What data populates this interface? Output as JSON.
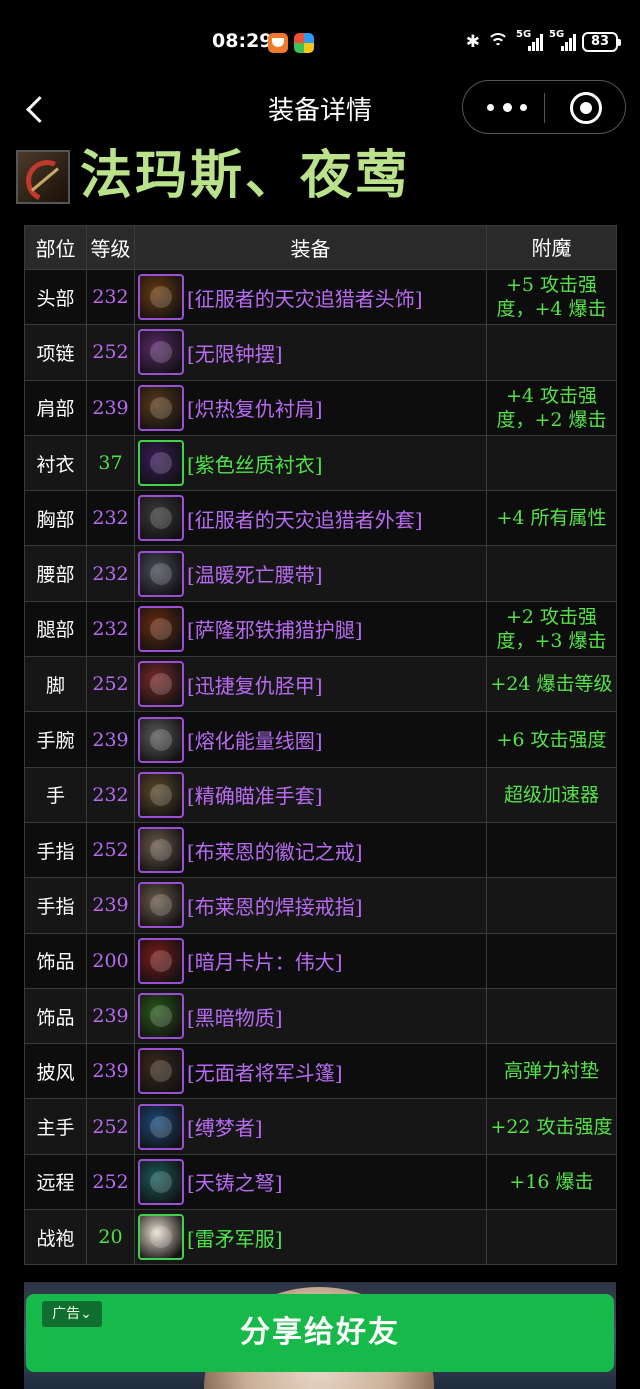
{
  "status_bar": {
    "time": "08:29",
    "network1": "5G",
    "network2": "5G",
    "battery": "83"
  },
  "nav": {
    "title": "装备详情"
  },
  "character": {
    "name": "法玛斯、夜莺"
  },
  "table": {
    "headers": {
      "slot": "部位",
      "level": "等级",
      "item": "装备",
      "enchant": "附魔"
    },
    "rows": [
      {
        "slot": "头部",
        "level": "232",
        "item": "[征服者的天灾追猎者头饰]",
        "enchant": "+5 攻击强度，+4 爆击",
        "quality": "epic",
        "icon": "helm-icon",
        "icon_color": "#6b3a10"
      },
      {
        "slot": "项链",
        "level": "252",
        "item": "[无限钟摆]",
        "enchant": "",
        "quality": "epic",
        "icon": "pendulum-icon",
        "icon_color": "#5a2a6a"
      },
      {
        "slot": "肩部",
        "level": "239",
        "item": "[炽热复仇衬肩]",
        "enchant": "+4 攻击强度，+2 爆击",
        "quality": "epic",
        "icon": "shoulder-icon",
        "icon_color": "#5a3a1a"
      },
      {
        "slot": "衬衣",
        "level": "37",
        "item": "[紫色丝质衬衣]",
        "enchant": "",
        "quality": "green",
        "icon": "shirt-icon",
        "icon_color": "#3a1a5a"
      },
      {
        "slot": "胸部",
        "level": "232",
        "item": "[征服者的天灾追猎者外套]",
        "enchant": "+4 所有属性",
        "quality": "epic",
        "icon": "chest-armor-icon",
        "icon_color": "#3a3a3a"
      },
      {
        "slot": "腰部",
        "level": "232",
        "item": "[温暖死亡腰带]",
        "enchant": "",
        "quality": "epic",
        "icon": "belt-icon",
        "icon_color": "#4a4a5a"
      },
      {
        "slot": "腿部",
        "level": "232",
        "item": "[萨隆邪铁捕猎护腿]",
        "enchant": "+2 攻击强度，+3 爆击",
        "quality": "epic",
        "icon": "legs-icon",
        "icon_color": "#6a2a10"
      },
      {
        "slot": "脚",
        "level": "252",
        "item": "[迅捷复仇胫甲]",
        "enchant": "+24 爆击等级",
        "quality": "epic",
        "icon": "boots-icon",
        "icon_color": "#7a2a2a"
      },
      {
        "slot": "手腕",
        "level": "239",
        "item": "[熔化能量线圈]",
        "enchant": "+6 攻击强度",
        "quality": "epic",
        "icon": "bracer-icon",
        "icon_color": "#5a5a5a"
      },
      {
        "slot": "手",
        "level": "232",
        "item": "[精确瞄准手套]",
        "enchant": "超级加速器",
        "quality": "epic",
        "icon": "gloves-icon",
        "icon_color": "#5a4a2a"
      },
      {
        "slot": "手指",
        "level": "252",
        "item": "[布莱恩的徽记之戒]",
        "enchant": "",
        "quality": "epic",
        "icon": "ring-icon",
        "icon_color": "#6a5a4a"
      },
      {
        "slot": "手指",
        "level": "239",
        "item": "[布莱恩的焊接戒指]",
        "enchant": "",
        "quality": "epic",
        "icon": "ring-icon",
        "icon_color": "#6a5a4a"
      },
      {
        "slot": "饰品",
        "level": "200",
        "item": "[暗月卡片：伟大]",
        "enchant": "",
        "quality": "epic",
        "icon": "card-icon",
        "icon_color": "#7a1a1a"
      },
      {
        "slot": "饰品",
        "level": "239",
        "item": "[黑暗物质]",
        "enchant": "",
        "quality": "epic",
        "icon": "orb-icon",
        "icon_color": "#2a5a1a"
      },
      {
        "slot": "披风",
        "level": "239",
        "item": "[无面者将军斗篷]",
        "enchant": "高弹力衬垫",
        "quality": "epic",
        "icon": "cloak-icon",
        "icon_color": "#3a2a1a"
      },
      {
        "slot": "主手",
        "level": "252",
        "item": "[缚梦者]",
        "enchant": "+22 攻击强度",
        "quality": "epic",
        "icon": "weapon-icon",
        "icon_color": "#1a4a7a"
      },
      {
        "slot": "远程",
        "level": "252",
        "item": "[天铸之弩]",
        "enchant": "+16 爆击",
        "quality": "epic",
        "icon": "crossbow-icon",
        "icon_color": "#1a5a5a"
      },
      {
        "slot": "战袍",
        "level": "20",
        "item": "[雷矛军服]",
        "enchant": "",
        "quality": "green",
        "icon": "tabard-icon",
        "icon_color": "#e8e0d0"
      }
    ]
  },
  "ad": {
    "tag": "广告⌄"
  },
  "share": {
    "label": "分享给好友"
  }
}
